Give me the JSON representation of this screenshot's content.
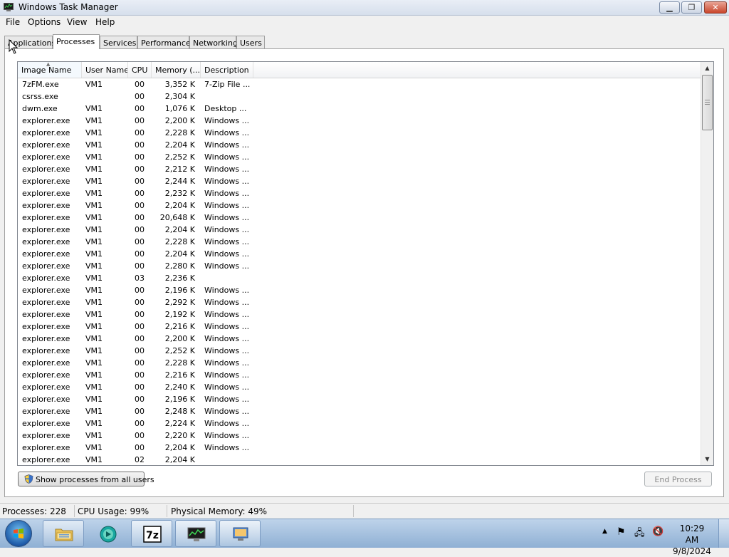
{
  "window": {
    "title": "Windows Task Manager"
  },
  "menu": [
    "File",
    "Options",
    "View",
    "Help"
  ],
  "tabs": [
    "Applications",
    "Processes",
    "Services",
    "Performance",
    "Networking",
    "Users"
  ],
  "active_tab": "Processes",
  "columns": {
    "name": "Image Name",
    "user": "User Name",
    "cpu": "CPU",
    "memory": "Memory (...",
    "description": "Description"
  },
  "rows": [
    {
      "name": "7zFM.exe",
      "user": "VM1",
      "cpu": "00",
      "mem": "3,352 K",
      "desc": "7-Zip File ..."
    },
    {
      "name": "csrss.exe",
      "user": "",
      "cpu": "00",
      "mem": "2,304 K",
      "desc": ""
    },
    {
      "name": "dwm.exe",
      "user": "VM1",
      "cpu": "00",
      "mem": "1,076 K",
      "desc": "Desktop ..."
    },
    {
      "name": "explorer.exe",
      "user": "VM1",
      "cpu": "00",
      "mem": "2,200 K",
      "desc": "Windows ..."
    },
    {
      "name": "explorer.exe",
      "user": "VM1",
      "cpu": "00",
      "mem": "2,228 K",
      "desc": "Windows ..."
    },
    {
      "name": "explorer.exe",
      "user": "VM1",
      "cpu": "00",
      "mem": "2,204 K",
      "desc": "Windows ..."
    },
    {
      "name": "explorer.exe",
      "user": "VM1",
      "cpu": "00",
      "mem": "2,252 K",
      "desc": "Windows ..."
    },
    {
      "name": "explorer.exe",
      "user": "VM1",
      "cpu": "00",
      "mem": "2,212 K",
      "desc": "Windows ..."
    },
    {
      "name": "explorer.exe",
      "user": "VM1",
      "cpu": "00",
      "mem": "2,244 K",
      "desc": "Windows ..."
    },
    {
      "name": "explorer.exe",
      "user": "VM1",
      "cpu": "00",
      "mem": "2,232 K",
      "desc": "Windows ..."
    },
    {
      "name": "explorer.exe",
      "user": "VM1",
      "cpu": "00",
      "mem": "2,204 K",
      "desc": "Windows ..."
    },
    {
      "name": "explorer.exe",
      "user": "VM1",
      "cpu": "00",
      "mem": "20,648 K",
      "desc": "Windows ..."
    },
    {
      "name": "explorer.exe",
      "user": "VM1",
      "cpu": "00",
      "mem": "2,204 K",
      "desc": "Windows ..."
    },
    {
      "name": "explorer.exe",
      "user": "VM1",
      "cpu": "00",
      "mem": "2,228 K",
      "desc": "Windows ..."
    },
    {
      "name": "explorer.exe",
      "user": "VM1",
      "cpu": "00",
      "mem": "2,204 K",
      "desc": "Windows ..."
    },
    {
      "name": "explorer.exe",
      "user": "VM1",
      "cpu": "00",
      "mem": "2,280 K",
      "desc": "Windows ..."
    },
    {
      "name": "explorer.exe",
      "user": "VM1",
      "cpu": "03",
      "mem": "2,236 K",
      "desc": ""
    },
    {
      "name": "explorer.exe",
      "user": "VM1",
      "cpu": "00",
      "mem": "2,196 K",
      "desc": "Windows ..."
    },
    {
      "name": "explorer.exe",
      "user": "VM1",
      "cpu": "00",
      "mem": "2,292 K",
      "desc": "Windows ..."
    },
    {
      "name": "explorer.exe",
      "user": "VM1",
      "cpu": "00",
      "mem": "2,192 K",
      "desc": "Windows ..."
    },
    {
      "name": "explorer.exe",
      "user": "VM1",
      "cpu": "00",
      "mem": "2,216 K",
      "desc": "Windows ..."
    },
    {
      "name": "explorer.exe",
      "user": "VM1",
      "cpu": "00",
      "mem": "2,200 K",
      "desc": "Windows ..."
    },
    {
      "name": "explorer.exe",
      "user": "VM1",
      "cpu": "00",
      "mem": "2,252 K",
      "desc": "Windows ..."
    },
    {
      "name": "explorer.exe",
      "user": "VM1",
      "cpu": "00",
      "mem": "2,228 K",
      "desc": "Windows ..."
    },
    {
      "name": "explorer.exe",
      "user": "VM1",
      "cpu": "00",
      "mem": "2,216 K",
      "desc": "Windows ..."
    },
    {
      "name": "explorer.exe",
      "user": "VM1",
      "cpu": "00",
      "mem": "2,240 K",
      "desc": "Windows ..."
    },
    {
      "name": "explorer.exe",
      "user": "VM1",
      "cpu": "00",
      "mem": "2,196 K",
      "desc": "Windows ..."
    },
    {
      "name": "explorer.exe",
      "user": "VM1",
      "cpu": "00",
      "mem": "2,248 K",
      "desc": "Windows ..."
    },
    {
      "name": "explorer.exe",
      "user": "VM1",
      "cpu": "00",
      "mem": "2,224 K",
      "desc": "Windows ..."
    },
    {
      "name": "explorer.exe",
      "user": "VM1",
      "cpu": "00",
      "mem": "2,220 K",
      "desc": "Windows ..."
    },
    {
      "name": "explorer.exe",
      "user": "VM1",
      "cpu": "00",
      "mem": "2,204 K",
      "desc": "Windows ..."
    },
    {
      "name": "explorer.exe",
      "user": "VM1",
      "cpu": "02",
      "mem": "2,204 K",
      "desc": ""
    }
  ],
  "buttons": {
    "show_all": "Show processes from all users",
    "end_process": "End Process"
  },
  "status": {
    "processes": "Processes: 228",
    "cpu": "CPU Usage: 99%",
    "memory": "Physical Memory: 49%"
  },
  "taskbar": {
    "apps": [
      {
        "icon": "folder-icon",
        "open": false
      },
      {
        "icon": "media-player-icon",
        "open": false
      },
      {
        "icon": "7zip-icon",
        "open": true
      },
      {
        "icon": "task-manager-icon",
        "open": true
      },
      {
        "icon": "remote-desktop-icon",
        "open": true
      }
    ],
    "clock_time": "10:29 AM",
    "clock_date": "9/8/2024"
  },
  "colors": {
    "titlebar": "#dbe4f1",
    "taskbar": "#a9c3e1",
    "close_button": "#c9462c"
  }
}
